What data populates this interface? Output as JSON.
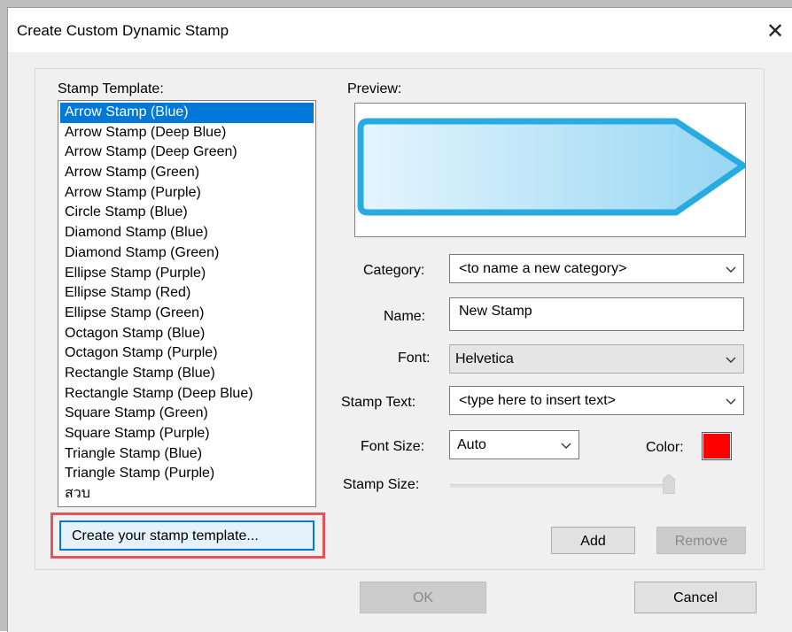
{
  "window": {
    "title": "Create Custom Dynamic Stamp",
    "close_glyph": "✕"
  },
  "stamp_template": {
    "label": "Stamp Template:",
    "selected_index": 0,
    "items": [
      "Arrow Stamp (Blue)",
      "Arrow Stamp (Deep Blue)",
      "Arrow Stamp (Deep Green)",
      "Arrow Stamp (Green)",
      "Arrow Stamp (Purple)",
      "Circle Stamp (Blue)",
      "Diamond Stamp (Blue)",
      "Diamond Stamp (Green)",
      "Ellipse Stamp (Purple)",
      "Ellipse Stamp (Red)",
      "Ellipse Stamp (Green)",
      "Octagon Stamp (Blue)",
      "Octagon Stamp (Purple)",
      "Rectangle Stamp (Blue)",
      "Rectangle Stamp (Deep Blue)",
      "Square Stamp (Green)",
      "Square Stamp (Purple)",
      "Triangle Stamp (Blue)",
      "Triangle Stamp (Purple)",
      "สวบ"
    ],
    "create_button_label": "Create your stamp template..."
  },
  "preview": {
    "label": "Preview:",
    "shape_icon": "arrow-stamp-blue",
    "stroke_color": "#29abe2",
    "fill_start": "#e4f5fd",
    "fill_end": "#96d6f3"
  },
  "form": {
    "category_label": "Category:",
    "category_value": "<to name a new category>",
    "name_label": "Name:",
    "name_value": "New Stamp",
    "font_label": "Font:",
    "font_value": "Helvetica",
    "stamp_text_label": "Stamp Text:",
    "stamp_text_value": "<type here to insert text>",
    "font_size_label": "Font Size:",
    "font_size_value": "Auto",
    "color_label": "Color:",
    "color_value": "#ff0000",
    "stamp_size_label": "Stamp Size:",
    "stamp_size_level": 1.0
  },
  "buttons": {
    "add": "Add",
    "remove": "Remove",
    "ok": "OK",
    "cancel": "Cancel"
  }
}
